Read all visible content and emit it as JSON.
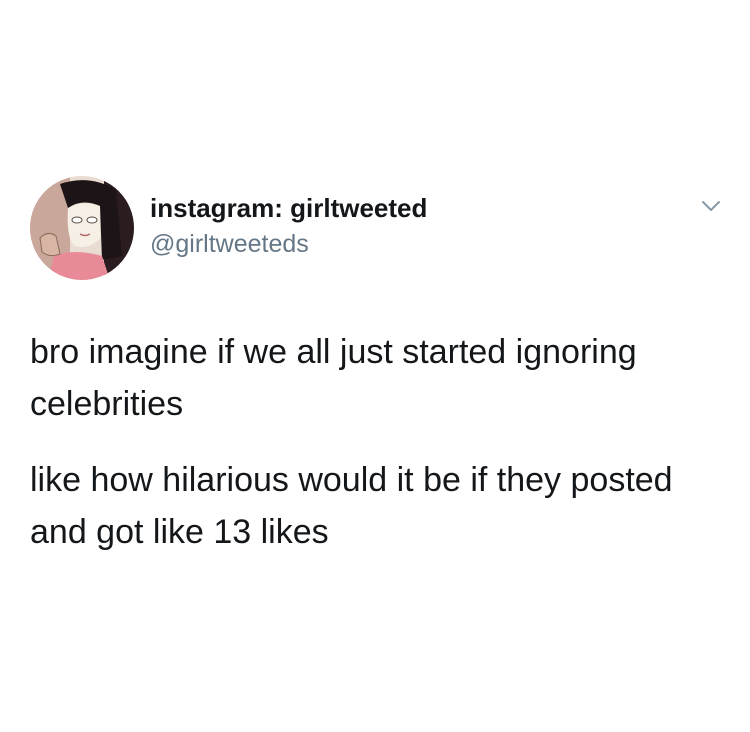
{
  "tweet": {
    "display_name": "instagram: girltweeted",
    "handle": "@girltweeteds",
    "paragraphs": [
      "bro imagine if we all just started ignoring celebrities",
      "like how hilarious would it be if they posted and got like 13 likes"
    ],
    "icons": {
      "avatar": "cartoon-avatar",
      "menu": "chevron-down-icon"
    }
  }
}
